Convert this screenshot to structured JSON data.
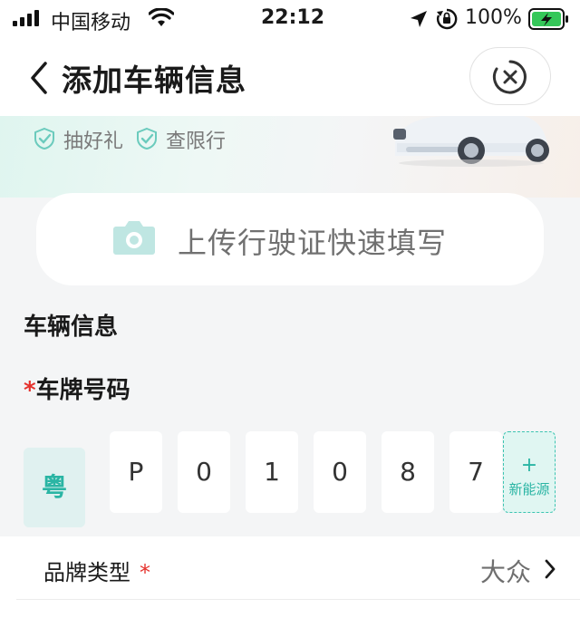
{
  "status_bar": {
    "carrier": "中国移动",
    "time": "22:12",
    "battery_pct": "100%"
  },
  "nav": {
    "title": "添加车辆信息"
  },
  "banner": {
    "perks": [
      "抽好礼",
      "查限行"
    ]
  },
  "upload": {
    "label": "上传行驶证快速填写"
  },
  "form": {
    "section_title": "车辆信息",
    "plate_label": "车牌号码",
    "required_mark": "*",
    "province": "粤",
    "plate_chars": [
      "P",
      "0",
      "1",
      "0",
      "8",
      "7"
    ],
    "new_energy_plus": "+",
    "new_energy_label": "新能源",
    "brand_label": "品牌类型",
    "brand_value": "大众"
  },
  "colors": {
    "accent": "#2ab5a4",
    "required": "#e5322d",
    "page_bg": "#f4f5f6"
  }
}
